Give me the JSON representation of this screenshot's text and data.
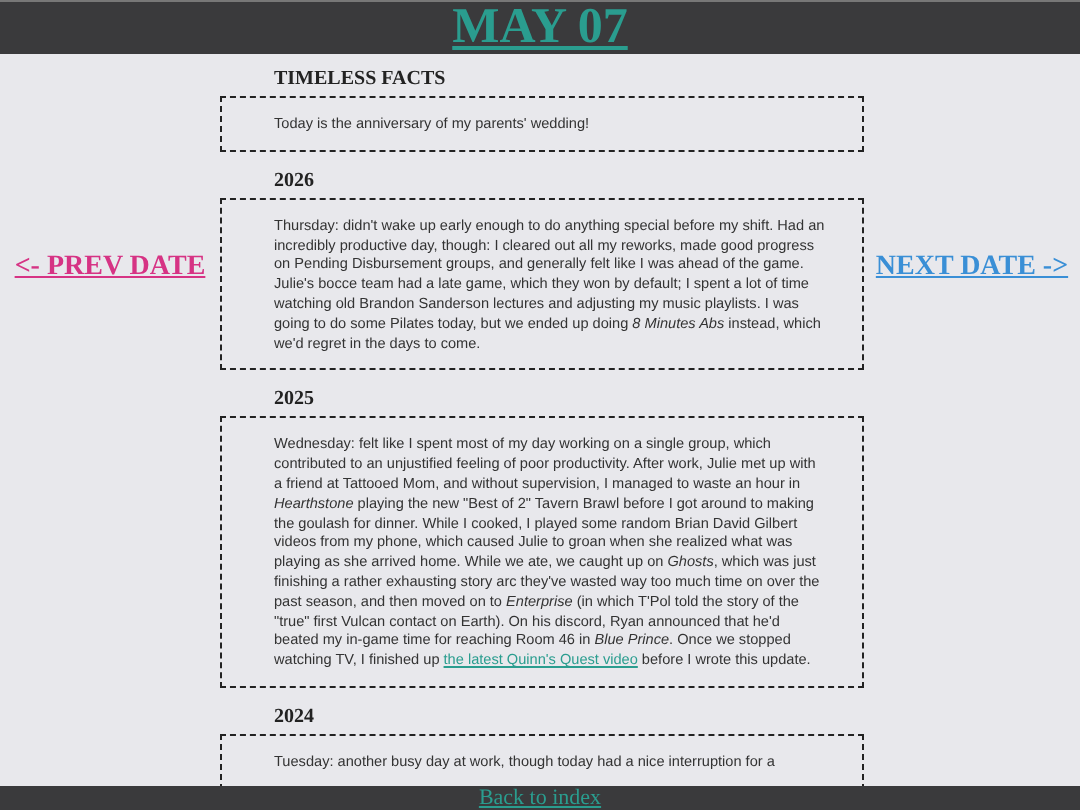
{
  "header": {
    "title": "MAY 07"
  },
  "nav": {
    "prev": "<- PREV DATE",
    "next": "NEXT DATE ->"
  },
  "sections": [
    {
      "heading": "TIMELESS FACTS",
      "segments": [
        {
          "kind": "text",
          "text": "Today is the anniversary of my parents' wedding!"
        }
      ]
    },
    {
      "heading": "2026",
      "segments": [
        {
          "kind": "text",
          "text": "Thursday: didn't wake up early enough to do anything special before my shift. Had an incredibly productive day, though: I cleared out all my reworks, made good progress on Pending Disbursement groups, and generally felt like I was ahead of the game. Julie's bocce team had a late game, which they won by default; I spent a lot of time watching old Brandon Sanderson lectures and adjusting my music playlists. I was going to do some Pilates today, but we ended up doing *8 Minutes Abs* instead, which we'd regret in the days to come."
        }
      ]
    },
    {
      "heading": "2025",
      "segments": [
        {
          "kind": "text",
          "text": "Wednesday: felt like I spent most of my day working on a single group, which contributed to an unjustified feeling of poor productivity. After work, Julie met up with a friend at Tattooed Mom, and without supervision, I managed to waste an hour in *Hearthstone* playing the new \"Best of 2\" Tavern Brawl before I got around to making the goulash for dinner. While I cooked, I played some random Brian David Gilbert videos from my phone, which caused Julie to groan when she realized what was playing as she arrived home. While we ate, we caught up on *Ghosts*, which was just finishing a rather exhausting story arc they've wasted way too much time on over the past season, and then moved on to *Enterprise* (in which T'Pol told the story of the \"true\" first Vulcan contact on Earth). On his discord, Ryan announced that he'd beated my in-game time for reaching Room 46 in *Blue Prince*. Once we stopped watching TV, I finished up "
        },
        {
          "kind": "link",
          "text": "the latest Quinn's Quest video"
        },
        {
          "kind": "text",
          "text": " before I wrote this update."
        }
      ]
    },
    {
      "heading": "2024",
      "segments": [
        {
          "kind": "text",
          "text": "Tuesday: another busy day at work, though today had a nice interruption for a"
        }
      ]
    }
  ],
  "footer": {
    "link": "Back to index"
  }
}
